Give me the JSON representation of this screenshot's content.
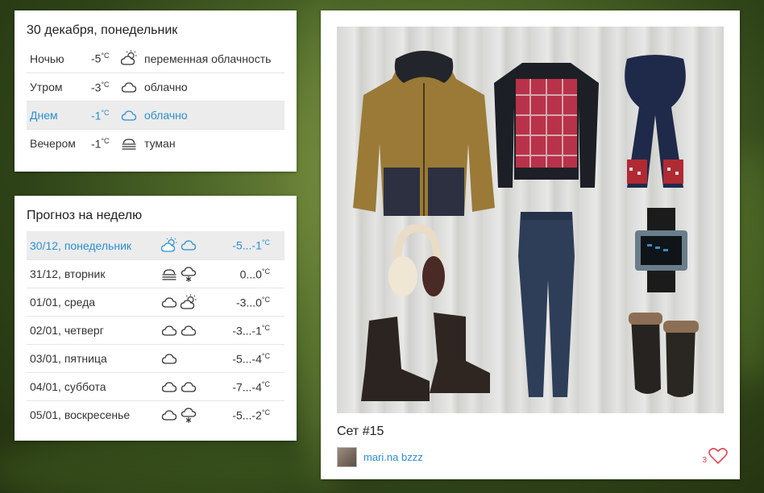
{
  "today": {
    "title": "30 декабря, понедельник",
    "rows": [
      {
        "part": "Ночью",
        "temp": "-5",
        "unit": "°C",
        "icon": "partly-cloudy-icon",
        "desc": "переменная облачность",
        "active": false
      },
      {
        "part": "Утром",
        "temp": "-3",
        "unit": "°C",
        "icon": "cloud-icon",
        "desc": "облачно",
        "active": false
      },
      {
        "part": "Днем",
        "temp": "-1",
        "unit": "°C",
        "icon": "cloud-icon",
        "desc": "облачно",
        "active": true
      },
      {
        "part": "Вечером",
        "temp": "-1",
        "unit": "°C",
        "icon": "fog-icon",
        "desc": "туман",
        "active": false
      }
    ]
  },
  "week": {
    "title": "Прогноз на неделю",
    "rows": [
      {
        "day": "30/12, понедельник",
        "icons": [
          "partly-cloudy-icon",
          "cloud-icon"
        ],
        "temp": "-5...-1",
        "unit": "°C",
        "active": true
      },
      {
        "day": "31/12, вторник",
        "icons": [
          "fog-icon",
          "snow-cloud-icon"
        ],
        "temp": "0...0",
        "unit": "°C",
        "active": false
      },
      {
        "day": "01/01, среда",
        "icons": [
          "cloud-icon",
          "partly-cloudy-icon"
        ],
        "temp": "-3...0",
        "unit": "°C",
        "active": false
      },
      {
        "day": "02/01, четверг",
        "icons": [
          "cloud-icon",
          "cloud-icon"
        ],
        "temp": "-3...-1",
        "unit": "°C",
        "active": false
      },
      {
        "day": "03/01, пятница",
        "icons": [
          "cloud-icon"
        ],
        "temp": "-5...-4",
        "unit": "°C",
        "active": false
      },
      {
        "day": "04/01, суббота",
        "icons": [
          "cloud-icon",
          "cloud-icon"
        ],
        "temp": "-7...-4",
        "unit": "°C",
        "active": false
      },
      {
        "day": "05/01, воскресенье",
        "icons": [
          "cloud-icon",
          "snow-cloud-icon"
        ],
        "temp": "-5...-2",
        "unit": "°C",
        "active": false
      }
    ]
  },
  "outfit": {
    "set_title": "Сет #15",
    "author": "mari.na bzzz",
    "likes": "3",
    "items": [
      "parka",
      "sweater",
      "scarf",
      "earmuffs",
      "watch",
      "jeans",
      "boots",
      "mittens"
    ]
  },
  "colors": {
    "accent": "#2a8fd1",
    "like": "#e2464f",
    "active_row": "#ececec"
  }
}
